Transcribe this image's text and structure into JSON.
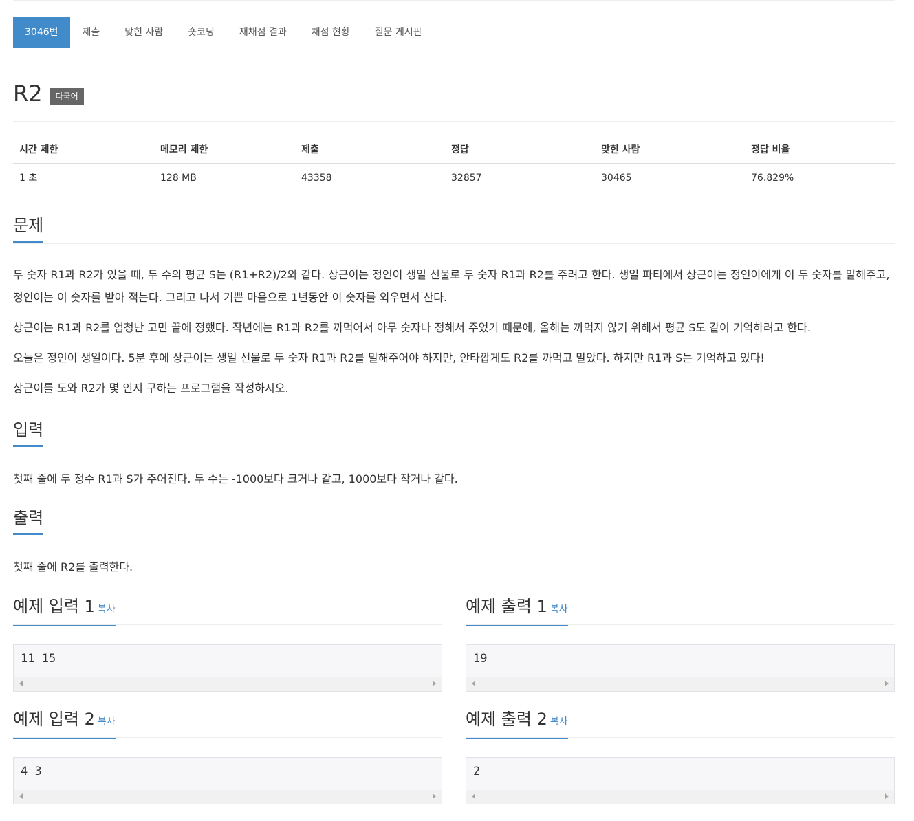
{
  "tabs": [
    {
      "label": "3046번",
      "active": true
    },
    {
      "label": "제출"
    },
    {
      "label": "맞힌 사람"
    },
    {
      "label": "숏코딩"
    },
    {
      "label": "재채점 결과"
    },
    {
      "label": "채점 현황"
    },
    {
      "label": "질문 게시판"
    }
  ],
  "problem": {
    "title": "R2",
    "badge": "다국어"
  },
  "info": {
    "headers": [
      "시간 제한",
      "메모리 제한",
      "제출",
      "정답",
      "맞힌 사람",
      "정답 비율"
    ],
    "values": [
      "1 초",
      "128 MB",
      "43358",
      "32857",
      "30465",
      "76.829%"
    ]
  },
  "sections": {
    "problem_heading": "문제",
    "problem_paragraphs": [
      "두 숫자 R1과 R2가 있을 때, 두 수의 평균 S는 (R1+R2)/2와 같다. 상근이는 정인이 생일 선물로 두 숫자 R1과 R2를 주려고 한다. 생일 파티에서 상근이는 정인이에게 이 두 숫자를 말해주고, 정인이는 이 숫자를 받아 적는다. 그리고 나서 기쁜 마음으로 1년동안 이 숫자를 외우면서 산다.",
      "상근이는 R1과 R2를 엄청난 고민 끝에 정했다. 작년에는 R1과 R2를 까먹어서 아무 숫자나 정해서 주었기 때문에, 올해는 까먹지 않기 위해서 평균 S도 같이 기억하려고 한다.",
      "오늘은 정인이 생일이다. 5분 후에 상근이는 생일 선물로 두 숫자 R1과 R2를 말해주어야 하지만, 안타깝게도 R2를 까먹고 말았다. 하지만 R1과 S는 기억하고 있다!",
      "상근이를 도와 R2가 몇 인지 구하는 프로그램을 작성하시오."
    ],
    "input_heading": "입력",
    "input_text": "첫째 줄에 두 정수 R1과 S가 주어진다. 두 수는 -1000보다 크거나 같고, 1000보다 작거나 같다.",
    "output_heading": "출력",
    "output_text": "첫째 줄에 R2를 출력한다."
  },
  "samples": {
    "copy_label": "복사",
    "input1_heading": "예제 입력 1",
    "input1": "11 15",
    "output1_heading": "예제 출력 1",
    "output1": "19",
    "input2_heading": "예제 입력 2",
    "input2": "4 3",
    "output2_heading": "예제 출력 2",
    "output2": "2"
  },
  "colors": {
    "accent": "#428bca",
    "badge": "#666666"
  }
}
